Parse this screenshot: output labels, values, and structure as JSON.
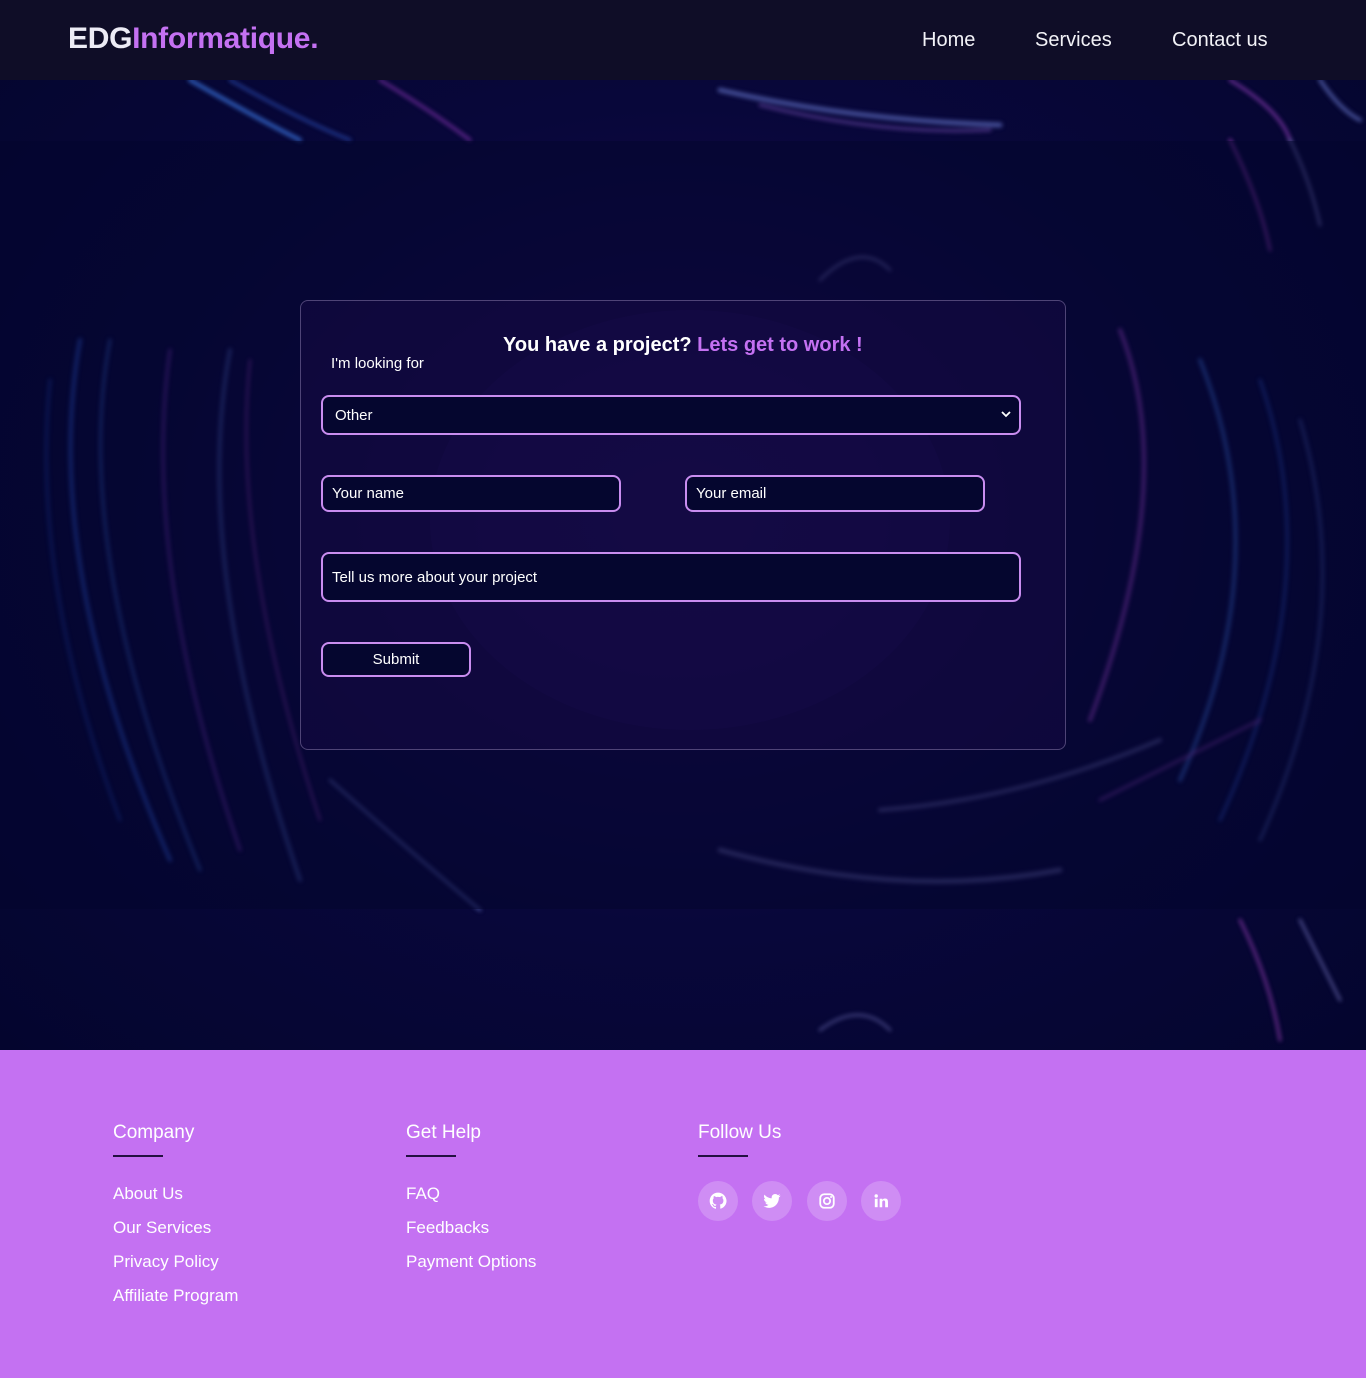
{
  "navbar": {
    "brand_part1": "EDG",
    "brand_part2": "Informatique.",
    "links": [
      "Home",
      "Services",
      "Contact us"
    ]
  },
  "form": {
    "title_main": "You have a project?",
    "title_accent": "Lets get to work !",
    "looking_label": "I'm looking for",
    "select_value": "Other",
    "name_placeholder": "Your name",
    "email_placeholder": "Your email",
    "project_placeholder": "Tell us more about your project",
    "submit_label": "Submit"
  },
  "footer": {
    "company": {
      "title": "Company",
      "links": [
        "About Us",
        "Our Services",
        "Privacy Policy",
        "Affiliate Program"
      ]
    },
    "help": {
      "title": "Get Help",
      "links": [
        "FAQ",
        "Feedbacks",
        "Payment Options"
      ]
    },
    "follow": {
      "title": "Follow Us",
      "icons": [
        "github-icon",
        "twitter-icon",
        "instagram-icon",
        "linkedin-icon"
      ]
    }
  },
  "colors": {
    "accent": "#c471f2",
    "navbar_bg": "#0f0d27",
    "page_bg": "#04052e",
    "footer_bg": "#c471f2"
  }
}
